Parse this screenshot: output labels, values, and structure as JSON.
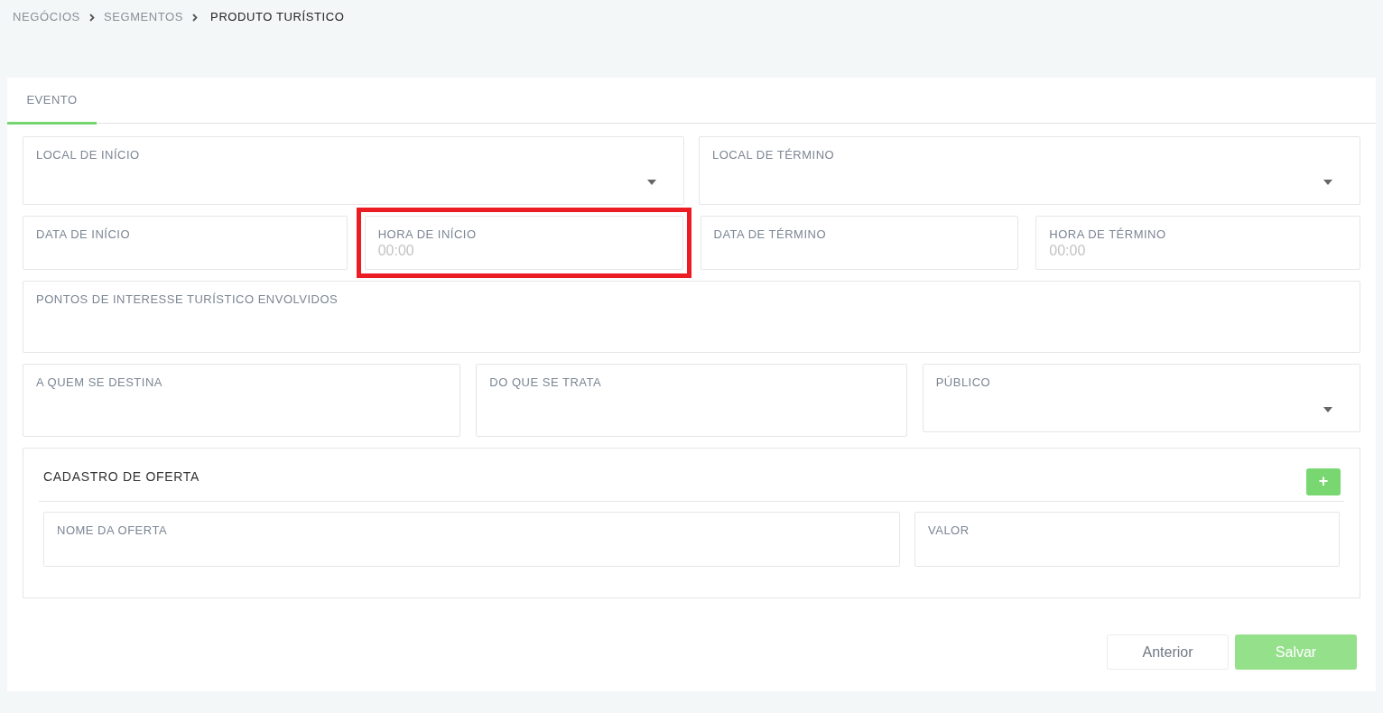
{
  "breadcrumb": [
    {
      "label": "NEGÓCIOS",
      "current": false
    },
    {
      "label": "SEGMENTOS",
      "current": false
    },
    {
      "label": "PRODUTO TURÍSTICO",
      "current": true
    }
  ],
  "tabs": [
    {
      "label": "EVENTO",
      "selected": true
    }
  ],
  "rows": [
    {
      "fields": [
        {
          "kind": "select",
          "label": "LOCAL DE INÍCIO",
          "highlighted": false
        },
        {
          "kind": "select",
          "label": "LOCAL DE TÉRMINO",
          "highlighted": false
        }
      ]
    },
    {
      "fields": [
        {
          "kind": "text",
          "label": "DATA DE INÍCIO",
          "highlighted": false
        },
        {
          "kind": "text",
          "label": "HORA DE INÍCIO",
          "placeholder": "00:00",
          "highlighted": true
        },
        {
          "kind": "text",
          "label": "DATA DE TÉRMINO",
          "highlighted": false
        },
        {
          "kind": "text",
          "label": "HORA DE TÉRMINO",
          "placeholder": "00:00",
          "highlighted": false
        }
      ]
    },
    {
      "fields": [
        {
          "kind": "textarea",
          "label": "PONTOS DE INTERESSE TURÍSTICO ENVOLVIDOS",
          "highlighted": false
        }
      ]
    },
    {
      "fields": [
        {
          "kind": "textarea",
          "label": "A QUEM SE DESTINA",
          "highlighted": false
        },
        {
          "kind": "textarea",
          "label": "DO QUE SE TRATA",
          "highlighted": false
        },
        {
          "kind": "select",
          "label": "PÚBLICO",
          "highlighted": false
        }
      ]
    }
  ],
  "offer": {
    "title": "CADASTRO DE OFERTA",
    "add_button": "+",
    "fields": [
      {
        "kind": "text",
        "label": "NOME DA OFERTA",
        "highlighted": false
      },
      {
        "kind": "text",
        "label": "VALOR",
        "highlighted": false
      }
    ]
  },
  "buttons": [
    {
      "label": "Anterior",
      "kind": "secondary"
    },
    {
      "label": "Salvar",
      "kind": "primary"
    }
  ]
}
